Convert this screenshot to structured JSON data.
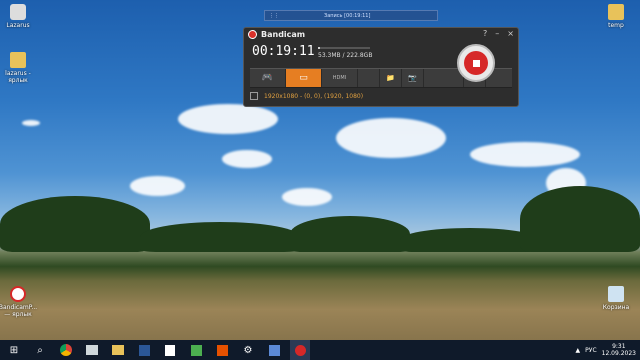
{
  "desktop": {
    "icons": [
      {
        "label": "Lazarus"
      },
      {
        "label": "lazarus - ярлык"
      },
      {
        "label": "temp"
      },
      {
        "label": "BandicamP... — ярлык"
      },
      {
        "label": "Корзина"
      }
    ]
  },
  "rec_area": {
    "title": "Запись [00:19:11]"
  },
  "bandicam": {
    "app_title": "Bandicam",
    "timer": "00:19:11",
    "size": "53.3MB / 222.8GB",
    "size_fraction": 0.04,
    "resolution": "1920x1080 - (0, 0), (1920, 1080)",
    "window_buttons": {
      "help": "?",
      "minimize": "–",
      "close": "×"
    },
    "toolbar": {
      "game": "🎮",
      "screen": "▭",
      "hdmi": "HDMI",
      "folder": "📁",
      "camera": "📷",
      "pause": "⏸"
    }
  },
  "taskbar": {
    "start": "⊞",
    "search": "⌕",
    "apps": [
      "chrome",
      "app",
      "files",
      "word",
      "notes",
      "app2",
      "media",
      "gear",
      "app3",
      "bandicam"
    ],
    "tray": {
      "lang": "РУС",
      "time": "9:31",
      "date": "12.09.2023"
    }
  },
  "colors": {
    "accent": "#e67e22",
    "record": "#d62828"
  }
}
